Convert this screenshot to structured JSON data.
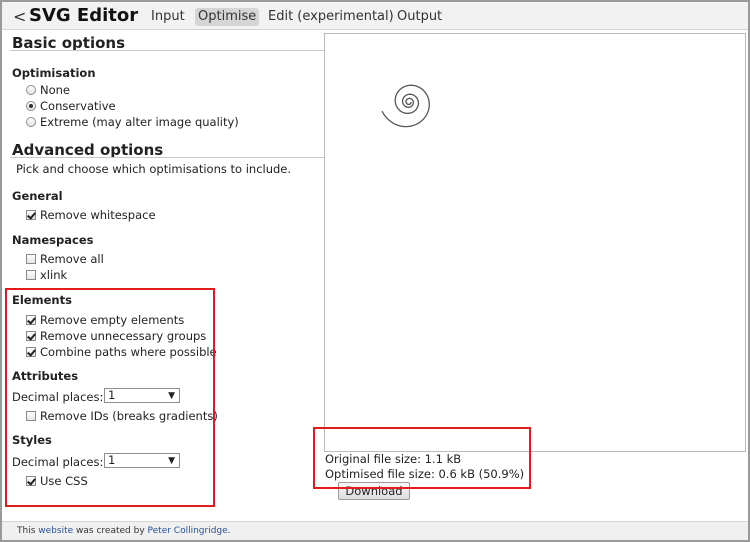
{
  "header": {
    "back_glyph": "<",
    "app_title": "SVG Editor",
    "tabs": [
      {
        "label": "Input"
      },
      {
        "label": "Optimise"
      },
      {
        "label": "Edit (experimental)"
      },
      {
        "label": "Output"
      }
    ],
    "active_tab": "Optimise"
  },
  "basic": {
    "heading": "Basic options",
    "optimisation": {
      "label": "Optimisation",
      "options": [
        "None",
        "Conservative",
        "Extreme (may alter image quality)"
      ],
      "selected": "Conservative"
    }
  },
  "advanced": {
    "heading": "Advanced options",
    "description": "Pick and choose which optimisations to include.",
    "general": {
      "label": "General",
      "remove_whitespace": {
        "label": "Remove whitespace",
        "checked": true
      }
    },
    "namespaces": {
      "label": "Namespaces",
      "remove_all": {
        "label": "Remove all",
        "checked": false
      },
      "xlink": {
        "label": "xlink",
        "checked": false
      }
    },
    "elements": {
      "label": "Elements",
      "remove_empty": {
        "label": "Remove empty elements",
        "checked": true
      },
      "remove_groups": {
        "label": "Remove unnecessary groups",
        "checked": true
      },
      "combine_paths": {
        "label": "Combine paths where possible",
        "checked": true
      }
    },
    "attributes": {
      "label": "Attributes",
      "decimal_label": "Decimal places:",
      "decimal_value": "1",
      "remove_ids": {
        "label": "Remove IDs (breaks gradients)",
        "checked": false
      }
    },
    "styles": {
      "label": "Styles",
      "decimal_label": "Decimal places:",
      "decimal_value": "1",
      "use_css": {
        "label": "Use CSS",
        "checked": true
      }
    }
  },
  "stats": {
    "original": "Original file size: 1.1 kB",
    "optimised": "Optimised file size: 0.6 kB (50.9%)"
  },
  "download_label": "Download",
  "footer": {
    "prefix": "This",
    "link_website": "website",
    "middle": "was created by",
    "link_author": "Peter Collingridge",
    "suffix": "."
  },
  "colors": {
    "highlight_box": "#e21b1b",
    "link": "#2a4f9c",
    "header_bg": "#f2f2f2",
    "active_tab_bg": "#d5d5d5"
  },
  "icons": {
    "back": "chevron-left-icon",
    "select_arrow": "triangle-down-icon",
    "preview_graphic": "spiral-graphic"
  }
}
